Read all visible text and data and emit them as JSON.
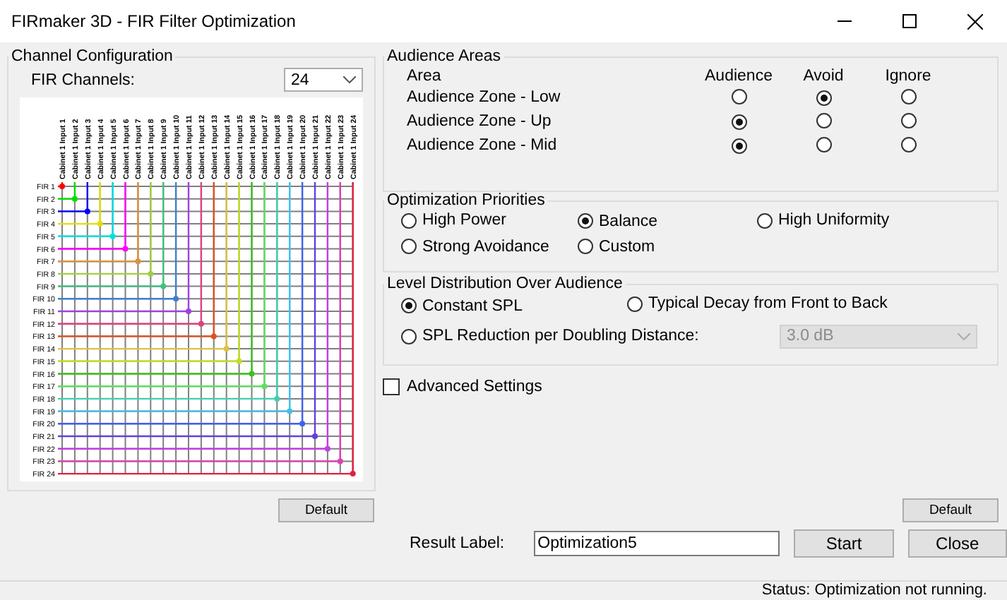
{
  "window": {
    "title": "FIRmaker 3D - FIR Filter Optimization"
  },
  "channel_configuration": {
    "title": "Channel Configuration",
    "fir_channels_label": "FIR Channels:",
    "fir_channels_value": "24",
    "default_button": "Default",
    "channels": [
      {
        "column_label": "Cabinet 1 Input 1",
        "row_label": "FIR 1",
        "color": "#ff0000"
      },
      {
        "column_label": "Cabinet 1 Input 2",
        "row_label": "FIR 2",
        "color": "#00e000"
      },
      {
        "column_label": "Cabinet 1 Input 3",
        "row_label": "FIR 3",
        "color": "#0000ff"
      },
      {
        "column_label": "Cabinet 1 Input 4",
        "row_label": "FIR 4",
        "color": "#e0e000"
      },
      {
        "column_label": "Cabinet 1 Input 5",
        "row_label": "FIR 5",
        "color": "#00e0e0"
      },
      {
        "column_label": "Cabinet 1 Input 6",
        "row_label": "FIR 6",
        "color": "#ff00ff"
      },
      {
        "column_label": "Cabinet 1 Input 7",
        "row_label": "FIR 7",
        "color": "#e09040"
      },
      {
        "column_label": "Cabinet 1 Input 8",
        "row_label": "FIR 8",
        "color": "#a0d040"
      },
      {
        "column_label": "Cabinet 1 Input 9",
        "row_label": "FIR 9",
        "color": "#40c080"
      },
      {
        "column_label": "Cabinet 1 Input 10",
        "row_label": "FIR 10",
        "color": "#4080d0"
      },
      {
        "column_label": "Cabinet 1 Input 11",
        "row_label": "FIR 11",
        "color": "#a040e0"
      },
      {
        "column_label": "Cabinet 1 Input 12",
        "row_label": "FIR 12",
        "color": "#e04080"
      },
      {
        "column_label": "Cabinet 1 Input 13",
        "row_label": "FIR 13",
        "color": "#e05020"
      },
      {
        "column_label": "Cabinet 1 Input 14",
        "row_label": "FIR 14",
        "color": "#e0c040"
      },
      {
        "column_label": "Cabinet 1 Input 15",
        "row_label": "FIR 15",
        "color": "#c0e020"
      },
      {
        "column_label": "Cabinet 1 Input 16",
        "row_label": "FIR 16",
        "color": "#40c020"
      },
      {
        "column_label": "Cabinet 1 Input 17",
        "row_label": "FIR 17",
        "color": "#60e060"
      },
      {
        "column_label": "Cabinet 1 Input 18",
        "row_label": "FIR 18",
        "color": "#40d0b0"
      },
      {
        "column_label": "Cabinet 1 Input 19",
        "row_label": "FIR 19",
        "color": "#40c0f0"
      },
      {
        "column_label": "Cabinet 1 Input 20",
        "row_label": "FIR 20",
        "color": "#4060f0"
      },
      {
        "column_label": "Cabinet 1 Input 21",
        "row_label": "FIR 21",
        "color": "#6040e0"
      },
      {
        "column_label": "Cabinet 1 Input 22",
        "row_label": "FIR 22",
        "color": "#c040e0"
      },
      {
        "column_label": "Cabinet 1 Input 23",
        "row_label": "FIR 23",
        "color": "#e040b0"
      },
      {
        "column_label": "Cabinet 1 Input 24",
        "row_label": "FIR 24",
        "color": "#e02040"
      }
    ]
  },
  "audience_areas": {
    "title": "Audience Areas",
    "columns": [
      "Area",
      "Audience",
      "Avoid",
      "Ignore"
    ],
    "rows": [
      {
        "name": "Audience Zone - Low",
        "options": [
          {
            "selected": false
          },
          {
            "selected": true
          },
          {
            "selected": false
          }
        ]
      },
      {
        "name": "Audience Zone - Up",
        "options": [
          {
            "selected": true
          },
          {
            "selected": false
          },
          {
            "selected": false
          }
        ]
      },
      {
        "name": "Audience Zone - Mid",
        "options": [
          {
            "selected": true
          },
          {
            "selected": false
          },
          {
            "selected": false
          }
        ]
      }
    ]
  },
  "optimization_priorities": {
    "title": "Optimization Priorities",
    "options": [
      {
        "label": "High Power",
        "selected": false
      },
      {
        "label": "Balance",
        "selected": true
      },
      {
        "label": "High Uniformity",
        "selected": false
      },
      {
        "label": "Strong Avoidance",
        "selected": false
      },
      {
        "label": "Custom",
        "selected": false
      }
    ]
  },
  "level_distribution": {
    "title": "Level Distribution Over Audience",
    "options": [
      {
        "label": "Constant SPL",
        "selected": true
      },
      {
        "label": "Typical Decay from Front to Back",
        "selected": false
      },
      {
        "label": "SPL Reduction per Doubling Distance:",
        "selected": false
      }
    ],
    "reduction_value": "3.0 dB",
    "reduction_disabled": true
  },
  "advanced_settings": {
    "label": "Advanced Settings",
    "checked": false
  },
  "default_button": "Default",
  "result_label": {
    "label": "Result Label:",
    "value": "Optimization5"
  },
  "buttons": [
    "Start",
    "Close"
  ],
  "status_bar": {
    "text": "Status: Optimization not running."
  }
}
